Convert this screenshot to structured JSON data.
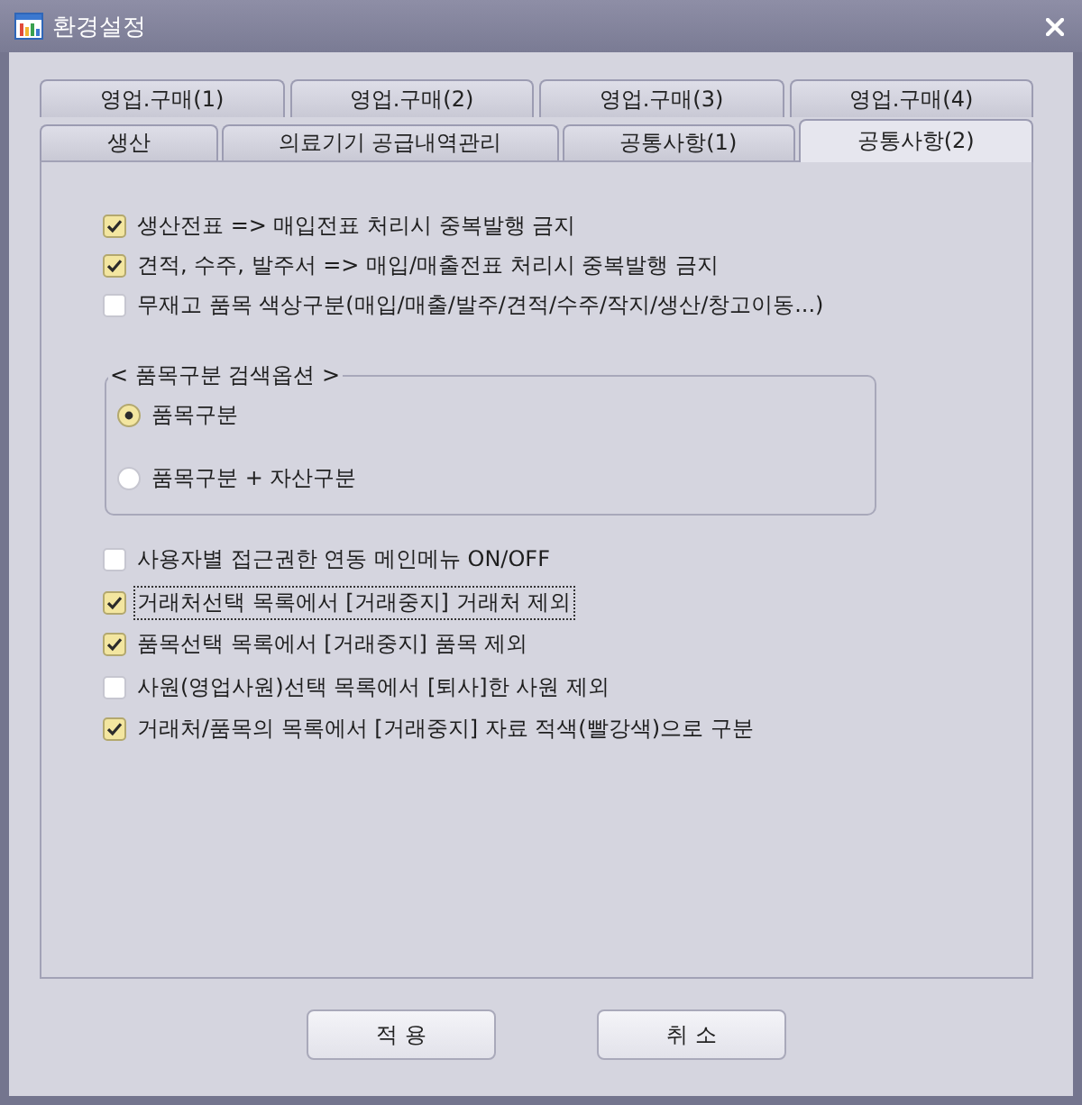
{
  "window": {
    "title": "환경설정"
  },
  "tabs": [
    [
      {
        "label": "영업.구매(1)",
        "selected": false
      },
      {
        "label": "영업.구매(2)",
        "selected": false
      },
      {
        "label": "영업.구매(3)",
        "selected": false
      },
      {
        "label": "영업.구매(4)",
        "selected": false
      }
    ],
    [
      {
        "label": "생산",
        "selected": false
      },
      {
        "label": "의료기기 공급내역관리",
        "selected": false
      },
      {
        "label": "공통사항(1)",
        "selected": false
      },
      {
        "label": "공통사항(2)",
        "selected": true
      }
    ]
  ],
  "options": [
    {
      "label": "생산전표 => 매입전표 처리시 중복발행 금지",
      "checked": true,
      "focused": false
    },
    {
      "label": "견적, 수주, 발주서 => 매입/매출전표 처리시 중복발행 금지",
      "checked": true,
      "focused": false
    },
    {
      "label": "무재고 품목 색상구분(매입/매출/발주/견적/수주/작지/생산/창고이동...)",
      "checked": false,
      "focused": false
    }
  ],
  "search_options": {
    "title": "< 품목구분 검색옵션 >",
    "choices": [
      {
        "label": "품목구분",
        "selected": true
      },
      {
        "label": "품목구분 + 자산구분",
        "selected": false
      }
    ]
  },
  "more_options": [
    {
      "label": "사용자별 접근권한 연동 메인메뉴 ON/OFF",
      "checked": false,
      "focused": false
    },
    {
      "label": "거래처선택 목록에서 [거래중지] 거래처 제외",
      "checked": true,
      "focused": true
    },
    {
      "label": "품목선택 목록에서 [거래중지] 품목 제외",
      "checked": true,
      "focused": false
    },
    {
      "label": "사원(영업사원)선택 목록에서 [퇴사]한 사원 제외",
      "checked": false,
      "focused": false
    },
    {
      "label": "거래처/품목의 목록에서 [거래중지] 자료 적색(빨강색)으로 구분",
      "checked": true,
      "focused": false
    }
  ],
  "buttons": [
    {
      "label": "적 용"
    },
    {
      "label": "취 소"
    }
  ]
}
